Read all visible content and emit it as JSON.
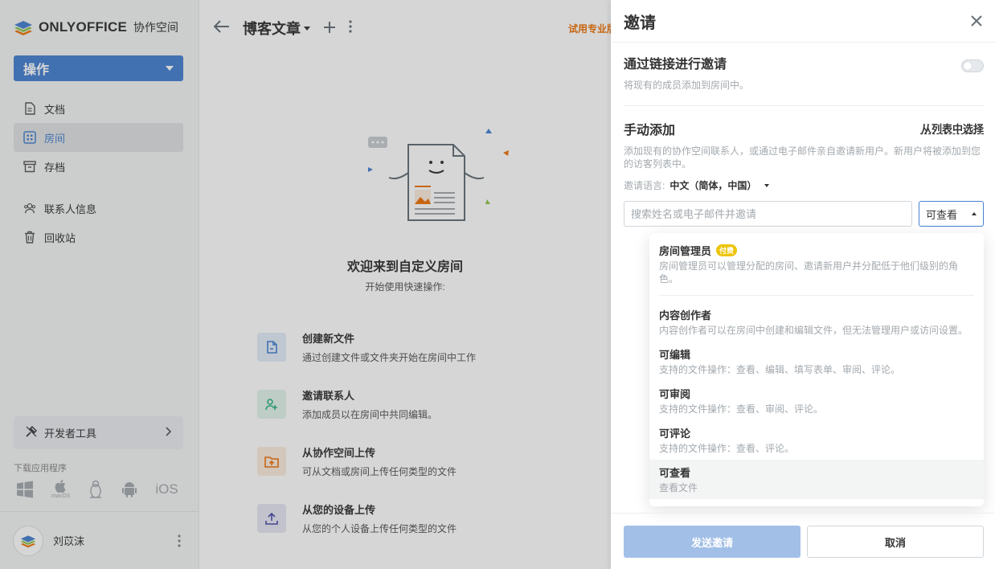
{
  "sidebar": {
    "logo_text": "ONLYOFFICE",
    "logo_sub": "协作空间",
    "actions_label": "操作",
    "items": [
      {
        "label": "文档",
        "icon": "document-icon"
      },
      {
        "label": "房间",
        "icon": "rooms-icon"
      },
      {
        "label": "存档",
        "icon": "archive-icon"
      },
      {
        "label": "联系人信息",
        "icon": "contacts-icon"
      },
      {
        "label": "回收站",
        "icon": "trash-icon"
      }
    ],
    "dev_tools": "开发者工具",
    "download_label": "下载应用程序",
    "apps": {
      "macos_caption": "macOS",
      "ios_label": "iOS"
    },
    "user_name": "刘苡沫"
  },
  "main": {
    "folder_title": "博客文章",
    "trial_label": "试用专业版",
    "welcome_title": "欢迎来到自定义房间",
    "welcome_sub": "开始使用快速操作:",
    "quick_actions": [
      {
        "title": "创建新文件",
        "desc": "通过创建文件或文件夹开始在房间中工作",
        "icon": "new-file-icon",
        "color": "#4781d1",
        "bg": "#e3edf9"
      },
      {
        "title": "邀请联系人",
        "desc": "添加成员以在房间中共同编辑。",
        "icon": "invite-user-icon",
        "color": "#2db482",
        "bg": "#e1f4ec"
      },
      {
        "title": "从协作空间上传",
        "desc": "可从文档或房间上传任何类型的文件",
        "icon": "upload-folder-icon",
        "color": "#ed7309",
        "bg": "#fcebde"
      },
      {
        "title": "从您的设备上传",
        "desc": "从您的个人设备上传任何类型的文件",
        "icon": "upload-device-icon",
        "color": "#4b4ba8",
        "bg": "#e6e6f4"
      }
    ]
  },
  "panel": {
    "title": "邀请",
    "link_invite_title": "通过链接进行邀请",
    "link_invite_desc": "将现有的成员添加到房间中。",
    "link_invite_enabled": false,
    "manual_title": "手动添加",
    "from_list": "从列表中选择",
    "manual_desc": "添加现有的协作空间联系人，或通过电子邮件亲自邀请新用户。新用户将被添加到您的访客列表中。",
    "lang_label": "邀请语言:",
    "lang_value": "中文（简体，中国）",
    "search_placeholder": "搜索姓名或电子邮件并邀请",
    "access_value": "可查看",
    "roles": [
      {
        "title": "房间管理员",
        "badge": "付费",
        "desc": "房间管理员可以管理分配的房间、邀请新用户并分配低于他们级别的角色。"
      },
      {
        "title": "内容创作者",
        "desc": "内容创作者可以在房间中创建和编辑文件，但无法管理用户或访问设置。"
      },
      {
        "title": "可编辑",
        "desc": "支持的文件操作：查看、编辑、填写表单、审阅、评论。"
      },
      {
        "title": "可审阅",
        "desc": "支持的文件操作：查看、审阅、评论。"
      },
      {
        "title": "可评论",
        "desc": "支持的文件操作：查看、评论。"
      },
      {
        "title": "可查看",
        "desc": "查看文件"
      }
    ],
    "send_label": "发送邀请",
    "cancel_label": "取消"
  }
}
